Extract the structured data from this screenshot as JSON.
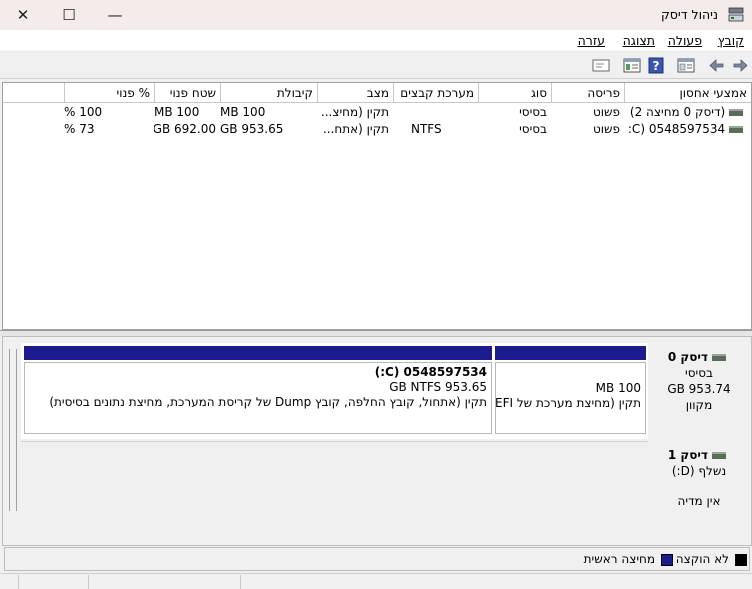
{
  "window": {
    "title": "ניהול דיסק",
    "close_glyph": "✕",
    "maximize_glyph": "☐",
    "minimize_glyph": "—"
  },
  "menu": [
    {
      "label": "קובץ"
    },
    {
      "label": "פעולה"
    },
    {
      "label": "תצוגה"
    },
    {
      "label": "עזרה"
    }
  ],
  "toolbar": {
    "icons": [
      "back-icon",
      "forward-icon",
      "properties-icon",
      "help-icon",
      "show-pane-icon",
      "settings-icon"
    ],
    "colors": {
      "help_bg": "#3a56b0"
    }
  },
  "volume_list": {
    "columns": [
      "אמצעי אחסון",
      "פריסה",
      "סוג",
      "מערכת קבצים",
      "מצב",
      "קיבולת",
      "שטח פנוי",
      "% פנוי"
    ],
    "rows": [
      {
        "volume": "(דיסק 0 מחיצה 2)",
        "layout": "פשוט",
        "type": "בסיסי",
        "fs": "",
        "status": "תקין (מחיצ...",
        "capacity": "100 MB",
        "free": "100 MB",
        "pct": "100 %"
      },
      {
        "volume": "0548597534 (C:)",
        "layout": "פשוט",
        "type": "בסיסי",
        "fs": "NTFS",
        "status": "תקין (אתח...",
        "capacity": "953.65 GB",
        "free": "692.00 GB",
        "pct": "73 %"
      }
    ]
  },
  "disks": [
    {
      "name": "דיסק 0",
      "type": "בסיסי",
      "size": "953.74 GB",
      "state": "מקוון",
      "partitions": [
        {
          "line1": "100 MB",
          "line2": "תקין (מחיצת מערכת של EFI"
        },
        {
          "title": "0548597534  (C:)",
          "line1": "953.65 GB NTFS",
          "line2": "תקין (אתחול, קובץ החלפה, קובץ Dump של קריסת המערכת, מחיצת נתונים בסיסית)"
        }
      ]
    },
    {
      "name": "דיסק 1",
      "type": "נשלף (D:)",
      "size": "",
      "state": "אין מדיה"
    }
  ],
  "legend": [
    {
      "label": "לא הוקצה",
      "color": "#000000"
    },
    {
      "label": "מחיצה ראשית",
      "color": "#1b1b8e"
    }
  ]
}
